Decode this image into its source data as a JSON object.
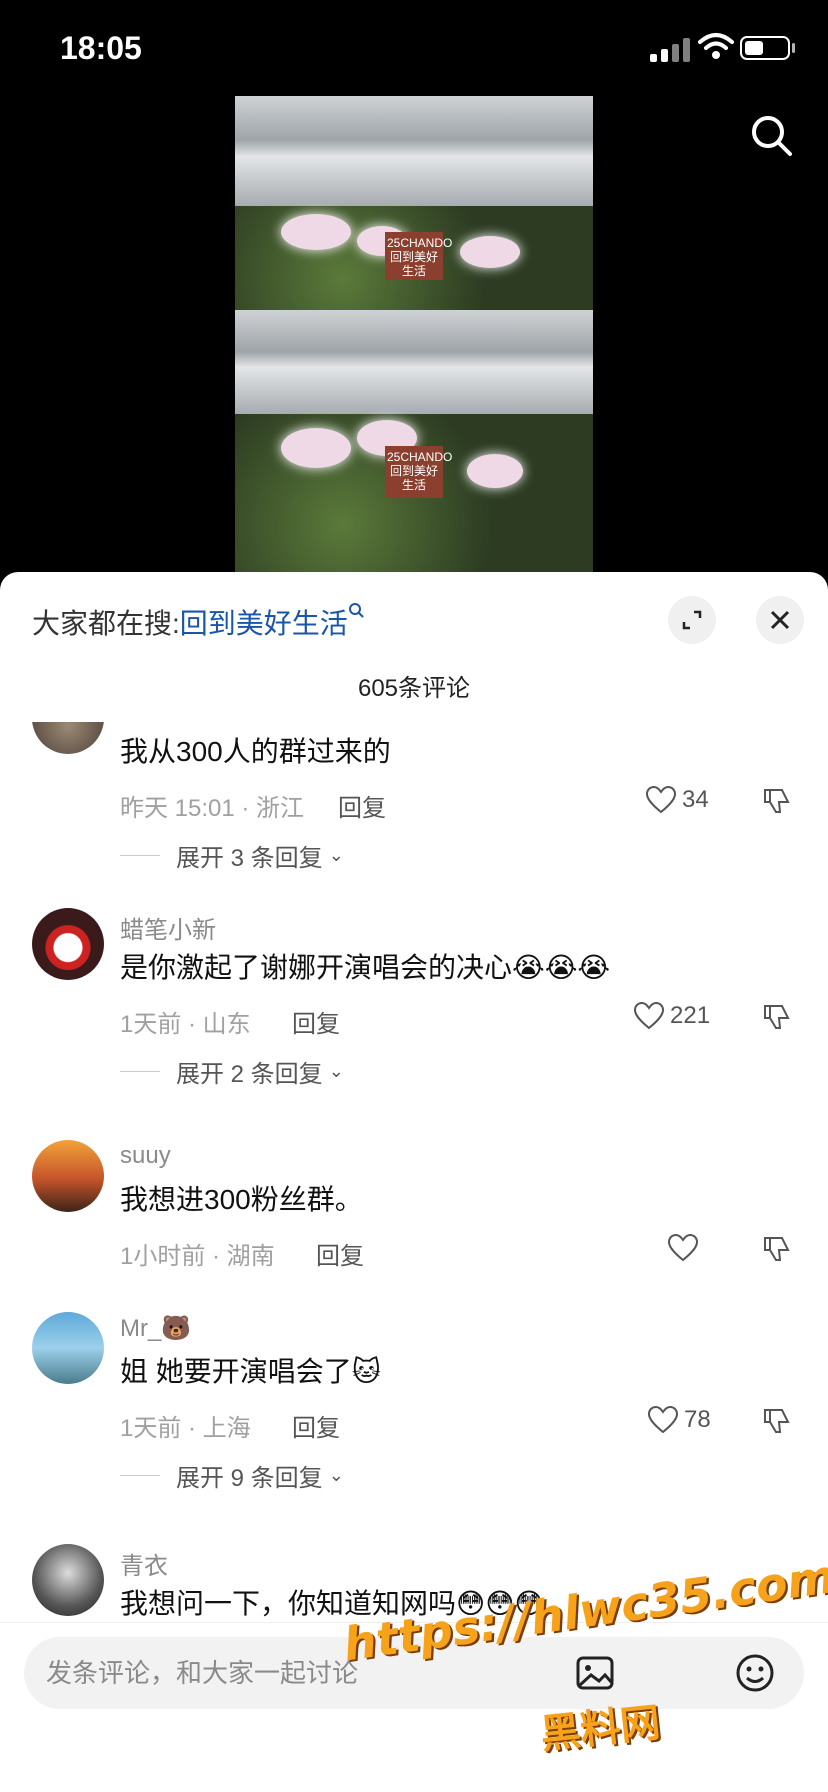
{
  "status": {
    "time": "18:05"
  },
  "sheet": {
    "everyone_prefix": "大家都在搜:",
    "keyword": "回到美好生活",
    "comment_count": "605条评论"
  },
  "comments": [
    {
      "user": "",
      "text": "我从300人的群过来的",
      "meta": "昨天 15:01 · 浙江",
      "reply": "回复",
      "likes": "34",
      "expand": "展开 3 条回复"
    },
    {
      "user": "蜡笔小新",
      "text": "是你激起了谢娜开演唱会的决心😭😭😭",
      "meta": "1天前 · 山东",
      "reply": "回复",
      "likes": "221",
      "expand": "展开 2 条回复"
    },
    {
      "user": "suuy",
      "text": "我想进300粉丝群。",
      "meta": "1小时前 · 湖南",
      "reply": "回复",
      "likes": ""
    },
    {
      "user": "Mr_🐻",
      "text": "姐 她要开演唱会了🐱",
      "meta": "1天前 · 上海",
      "reply": "回复",
      "likes": "78",
      "expand": "展开 9 条回复"
    },
    {
      "user": "青衣",
      "text": "我想问一下，你知道知网吗😳😳😳",
      "meta": "",
      "reply": ""
    }
  ],
  "input": {
    "placeholder": "发条评论，和大家一起讨论"
  },
  "watermark": {
    "line1": "https://hlwc35.com",
    "line2": "黑料网"
  },
  "video": {
    "sign_text": "25CHANDO 回到美好生活"
  },
  "colors": {
    "keyword": "#1a56a8",
    "watermark": "#f7a21b"
  }
}
